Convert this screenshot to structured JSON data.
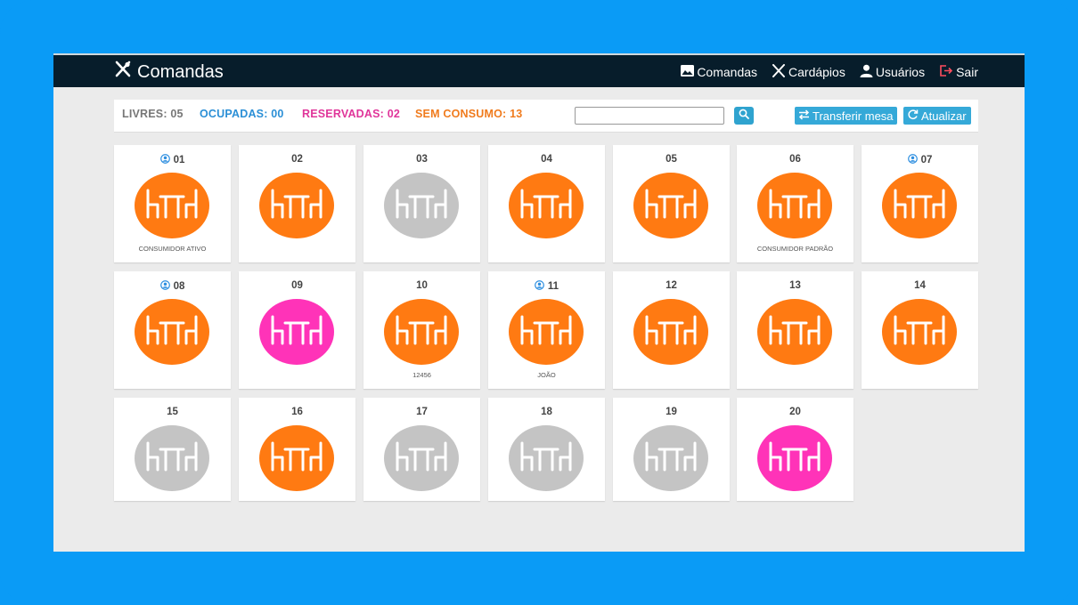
{
  "navbar": {
    "brand": "Comandas",
    "links": [
      {
        "label": "Comandas",
        "icon": "image-icon"
      },
      {
        "label": "Cardápios",
        "icon": "utensils-icon"
      },
      {
        "label": "Usuários",
        "icon": "user-icon"
      },
      {
        "label": "Sair",
        "icon": "logout-icon"
      }
    ]
  },
  "toolbar": {
    "stats": [
      {
        "label": "LIVRES: 05",
        "color": "#777777"
      },
      {
        "label": "OCUPADAS: 00",
        "color": "#2b8fd6"
      },
      {
        "label": "RESERVADAS: 02",
        "color": "#e0359a"
      },
      {
        "label": "SEM CONSUMO: 13",
        "color": "#f07b1d"
      }
    ],
    "search": {
      "value": "",
      "placeholder": ""
    },
    "transfer_label": "Transferir mesa",
    "refresh_label": "Atualizar"
  },
  "colors": {
    "orange": "#ff7a12",
    "gray": "#c4c4c4",
    "pink": "#ff33b8",
    "user_icon": "#2e8fe0"
  },
  "tables": [
    {
      "number": "01",
      "status": "orange",
      "user": true,
      "caption": "CONSUMIDOR ATIVO"
    },
    {
      "number": "02",
      "status": "orange",
      "user": false,
      "caption": ""
    },
    {
      "number": "03",
      "status": "gray",
      "user": false,
      "caption": ""
    },
    {
      "number": "04",
      "status": "orange",
      "user": false,
      "caption": ""
    },
    {
      "number": "05",
      "status": "orange",
      "user": false,
      "caption": ""
    },
    {
      "number": "06",
      "status": "orange",
      "user": false,
      "caption": "CONSUMIDOR PADRÃO"
    },
    {
      "number": "07",
      "status": "orange",
      "user": true,
      "caption": ""
    },
    {
      "number": "08",
      "status": "orange",
      "user": true,
      "caption": ""
    },
    {
      "number": "09",
      "status": "pink",
      "user": false,
      "caption": ""
    },
    {
      "number": "10",
      "status": "orange",
      "user": false,
      "caption": "12456"
    },
    {
      "number": "11",
      "status": "orange",
      "user": true,
      "caption": "JOÃO"
    },
    {
      "number": "12",
      "status": "orange",
      "user": false,
      "caption": ""
    },
    {
      "number": "13",
      "status": "orange",
      "user": false,
      "caption": ""
    },
    {
      "number": "14",
      "status": "orange",
      "user": false,
      "caption": ""
    },
    {
      "number": "15",
      "status": "gray",
      "user": false,
      "caption": ""
    },
    {
      "number": "16",
      "status": "orange",
      "user": false,
      "caption": ""
    },
    {
      "number": "17",
      "status": "gray",
      "user": false,
      "caption": ""
    },
    {
      "number": "18",
      "status": "gray",
      "user": false,
      "caption": ""
    },
    {
      "number": "19",
      "status": "gray",
      "user": false,
      "caption": ""
    },
    {
      "number": "20",
      "status": "pink",
      "user": false,
      "caption": ""
    }
  ]
}
